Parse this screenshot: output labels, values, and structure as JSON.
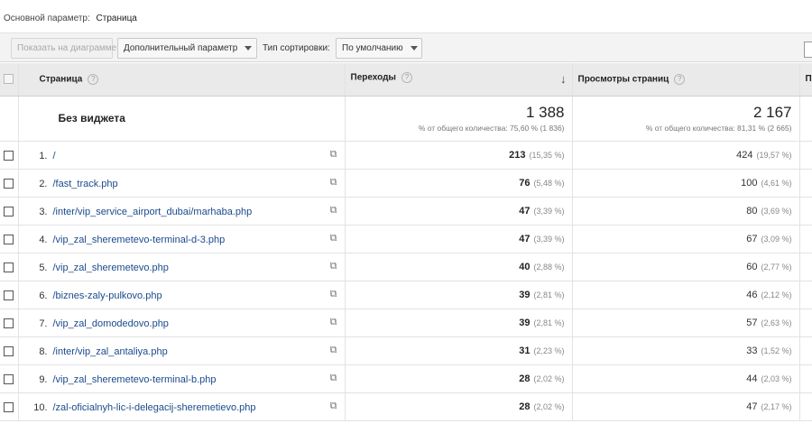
{
  "primary_dimension": {
    "label": "Основной параметр:",
    "value": "Страница"
  },
  "toolbar": {
    "show_on_chart": "Показать на диаграмме",
    "secondary_dimension": "Дополнительный параметр",
    "sort_type_label": "Тип сортировки:",
    "sort_type_value": "По умолчанию"
  },
  "table": {
    "headers": {
      "page": "Страница",
      "entrances": "Переходы",
      "pageviews": "Просмотры страниц",
      "next": "П"
    },
    "help_glyph": "?",
    "sort_glyph": "↓",
    "ext_glyph": "⧉",
    "summary": {
      "label": "Без виджета",
      "entrances_total": "1 388",
      "entrances_note": "% от общего количества: 75,60 % (1 836)",
      "pageviews_total": "2 167",
      "pageviews_note": "% от общего количества: 81,31 % (2 665)"
    },
    "rows": [
      {
        "index": "1.",
        "page": "/",
        "entrances": "213",
        "entrances_pct": "(15,35 %)",
        "pageviews": "424",
        "pageviews_pct": "(19,57 %)"
      },
      {
        "index": "2.",
        "page": "/fast_track.php",
        "entrances": "76",
        "entrances_pct": "(5,48 %)",
        "pageviews": "100",
        "pageviews_pct": "(4,61 %)"
      },
      {
        "index": "3.",
        "page": "/inter/vip_service_airport_dubai/marhaba.php",
        "entrances": "47",
        "entrances_pct": "(3,39 %)",
        "pageviews": "80",
        "pageviews_pct": "(3,69 %)"
      },
      {
        "index": "4.",
        "page": "/vip_zal_sheremetevo-terminal-d-3.php",
        "entrances": "47",
        "entrances_pct": "(3,39 %)",
        "pageviews": "67",
        "pageviews_pct": "(3,09 %)"
      },
      {
        "index": "5.",
        "page": "/vip_zal_sheremetevo.php",
        "entrances": "40",
        "entrances_pct": "(2,88 %)",
        "pageviews": "60",
        "pageviews_pct": "(2,77 %)"
      },
      {
        "index": "6.",
        "page": "/biznes-zaly-pulkovo.php",
        "entrances": "39",
        "entrances_pct": "(2,81 %)",
        "pageviews": "46",
        "pageviews_pct": "(2,12 %)"
      },
      {
        "index": "7.",
        "page": "/vip_zal_domodedovo.php",
        "entrances": "39",
        "entrances_pct": "(2,81 %)",
        "pageviews": "57",
        "pageviews_pct": "(2,63 %)"
      },
      {
        "index": "8.",
        "page": "/inter/vip_zal_antaliya.php",
        "entrances": "31",
        "entrances_pct": "(2,23 %)",
        "pageviews": "33",
        "pageviews_pct": "(1,52 %)"
      },
      {
        "index": "9.",
        "page": "/vip_zal_sheremetevo-terminal-b.php",
        "entrances": "28",
        "entrances_pct": "(2,02 %)",
        "pageviews": "44",
        "pageviews_pct": "(2,03 %)"
      },
      {
        "index": "10.",
        "page": "/zal-oficialnyh-lic-i-delegacij-sheremetievo.php",
        "entrances": "28",
        "entrances_pct": "(2,02 %)",
        "pageviews": "47",
        "pageviews_pct": "(2,17 %)"
      }
    ]
  }
}
